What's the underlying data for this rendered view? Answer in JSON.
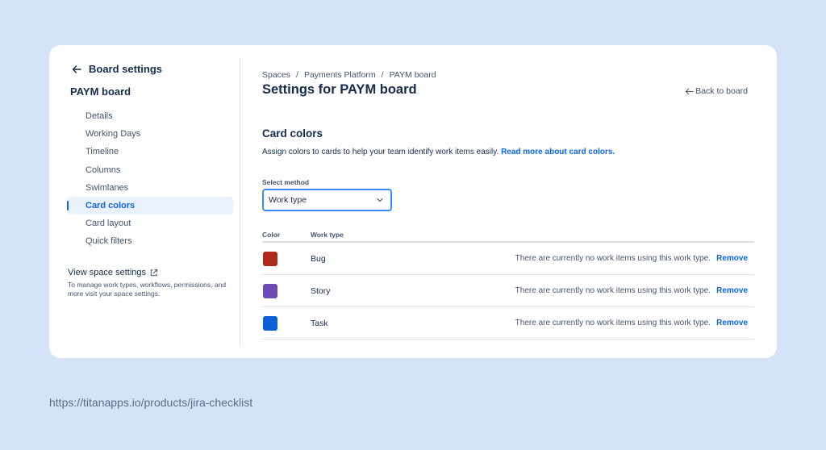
{
  "sidebar": {
    "back_title": "Board settings",
    "board_name": "PAYM board",
    "items": [
      {
        "label": "Details",
        "active": false
      },
      {
        "label": "Working Days",
        "active": false
      },
      {
        "label": "Timeline",
        "active": false
      },
      {
        "label": "Columns",
        "active": false
      },
      {
        "label": "Swimlanes",
        "active": false
      },
      {
        "label": "Card colors",
        "active": true
      },
      {
        "label": "Card layout",
        "active": false
      },
      {
        "label": "Quick filters",
        "active": false
      }
    ],
    "view_space_settings": "View space settings",
    "view_space_desc": "To manage work types, workflows, permissions, and more visit your space settings."
  },
  "header": {
    "breadcrumb": [
      "Spaces",
      "Payments Platform",
      "PAYM board"
    ],
    "title": "Settings for PAYM board",
    "back_to_board": "Back to board"
  },
  "section": {
    "title": "Card colors",
    "description": "Assign colors to cards to help your team identify work items easily.",
    "link_text": "Read more about card colors.",
    "select_label": "Select method",
    "select_value": "Work type"
  },
  "table": {
    "col_color": "Color",
    "col_type": "Work type",
    "rows": [
      {
        "color": "#ae2a19",
        "type": "Bug",
        "status": "There are currently no work items using this work type.",
        "action": "Remove"
      },
      {
        "color": "#6e4cb7",
        "type": "Story",
        "status": "There are currently no work items using this work type.",
        "action": "Remove"
      },
      {
        "color": "#0c5fd4",
        "type": "Task",
        "status": "There are currently no work items using this work type.",
        "action": "Remove"
      }
    ]
  },
  "footer_url": "https://titanapps.io/products/jira-checklist",
  "colors": {
    "accent": "#0c66e4",
    "background": "#d4e3f7"
  }
}
